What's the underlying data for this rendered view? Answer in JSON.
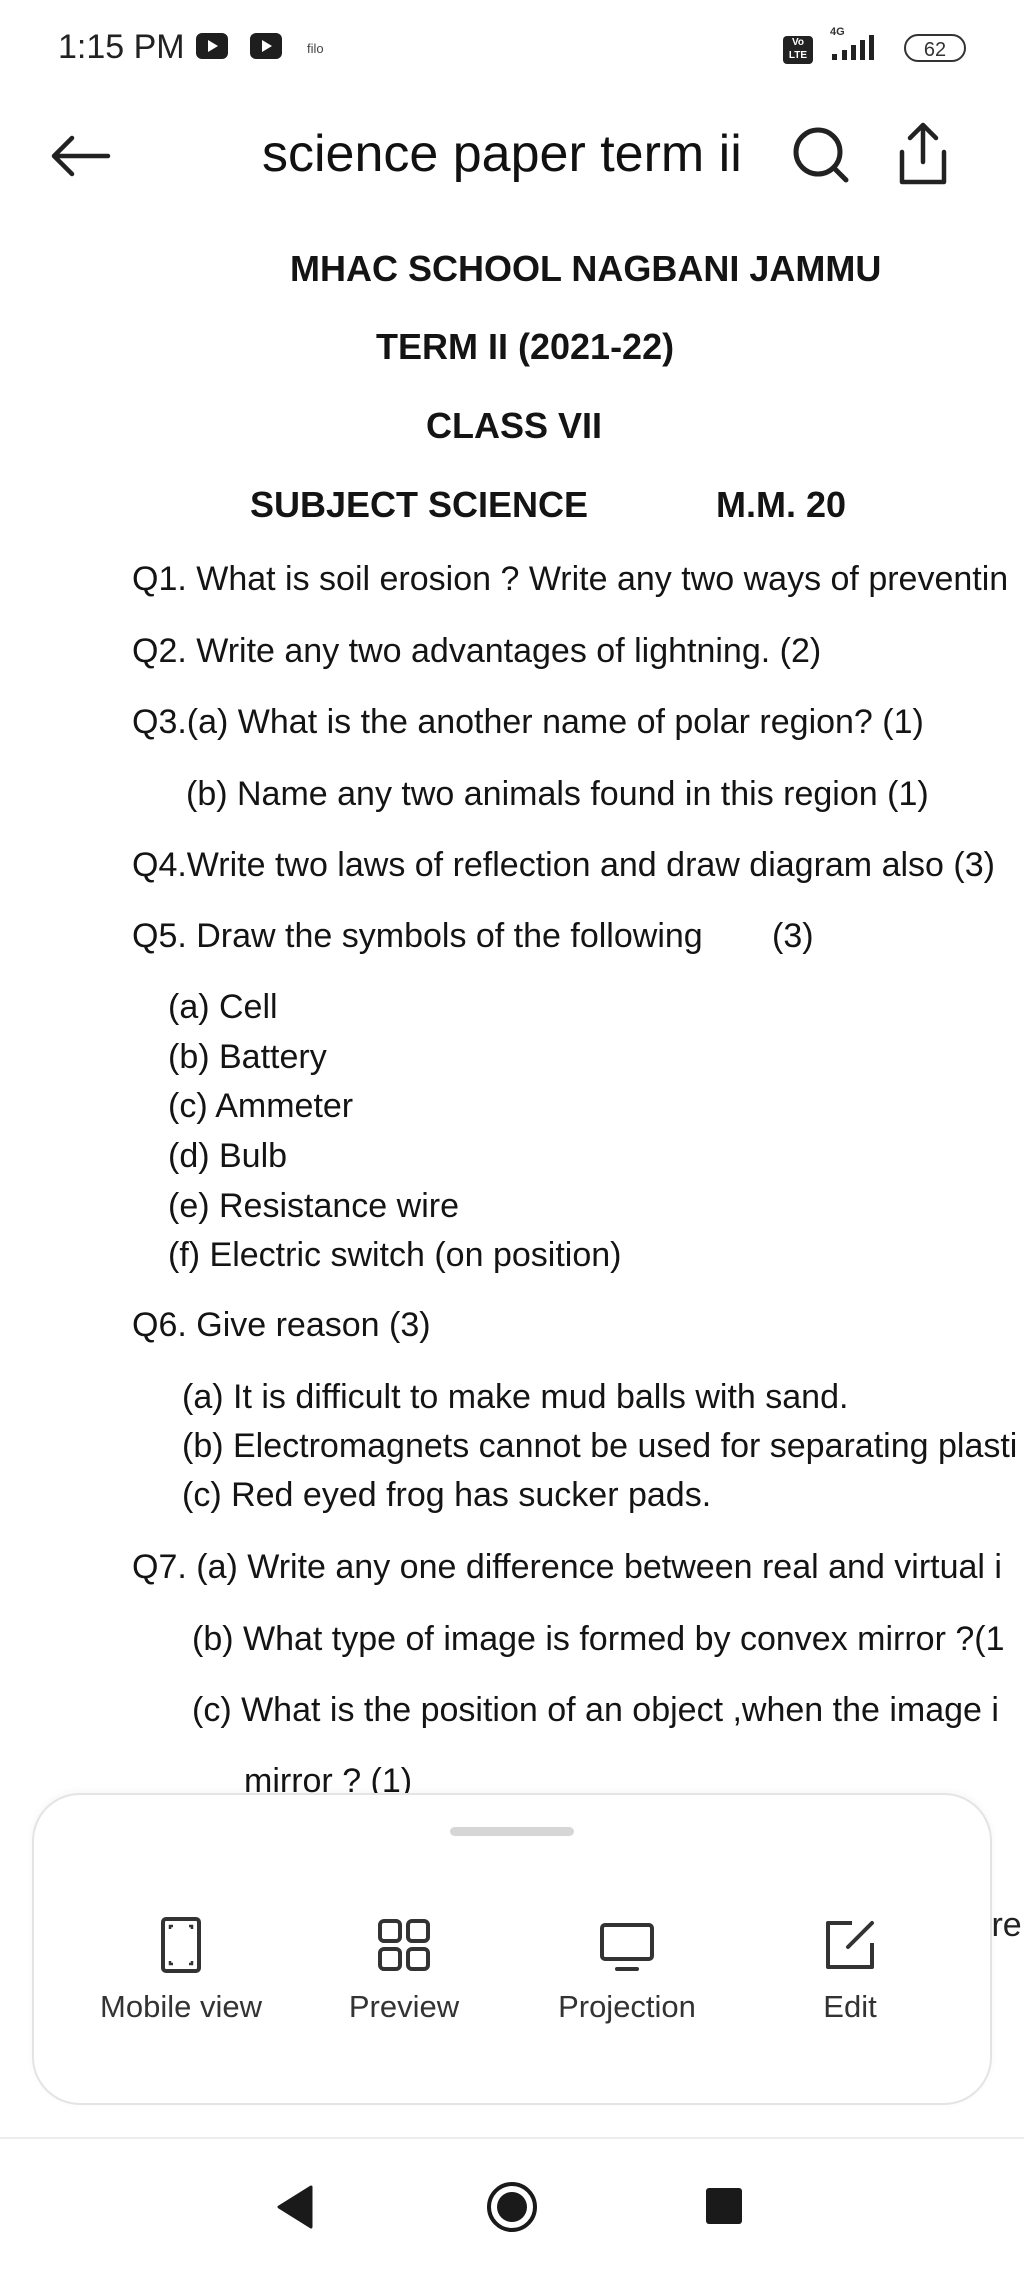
{
  "status_bar": {
    "time": "1:15 PM",
    "notification_icons": [
      "youtube-icon",
      "youtube-icon"
    ],
    "filo_label": "filo",
    "volte_label": "Vo LTE",
    "network_label": "4G",
    "battery_level": "62"
  },
  "header": {
    "title": "science paper term ii",
    "icons": [
      "back-arrow-icon",
      "search-icon",
      "share-icon"
    ]
  },
  "document": {
    "school": "MHAC SCHOOL NAGBANI JAMMU",
    "term": "TERM II (2021-22)",
    "class_name": "CLASS VII",
    "subject": "SUBJECT SCIENCE",
    "max_marks": "M.M. 20",
    "lines": [
      "Q1. What is soil erosion ? Write any two ways of preventin",
      "Q2. Write any two advantages of lightning. (2)",
      "Q3.(a) What is the another name of polar region? (1)",
      "(b) Name any two animals found in this region (1)",
      "Q4.Write two laws of reflection and draw diagram also (3)",
      "Q5. Draw the symbols of the following",
      "(3)",
      "(a) Cell",
      "(b) Battery",
      "(c) Ammeter",
      "(d) Bulb",
      "(e) Resistance wire",
      "(f)  Electric switch (on position)",
      "Q6. Give reason   (3)",
      "(a) It is difficult to make mud balls with sand.",
      "(b) Electromagnets cannot be used for separating plasti",
      "(c) Red eyed frog has sucker pads.",
      "Q7. (a) Write any one difference between real and virtual i",
      "(b) What type of image is formed by convex mirror ?(1",
      "(c) What is the position of an object ,when the image i",
      "mirror ? (1)"
    ]
  },
  "bottom_sheet": {
    "actions": [
      {
        "label": "Mobile view",
        "icon": "mobile-view-icon"
      },
      {
        "label": "Preview",
        "icon": "grid-preview-icon"
      },
      {
        "label": "Projection",
        "icon": "monitor-icon"
      },
      {
        "label": "Edit",
        "icon": "edit-icon"
      }
    ],
    "peek_text": ":re"
  },
  "nav_bar": {
    "icons": [
      "nav-back-icon",
      "nav-home-icon",
      "nav-recent-icon"
    ]
  }
}
